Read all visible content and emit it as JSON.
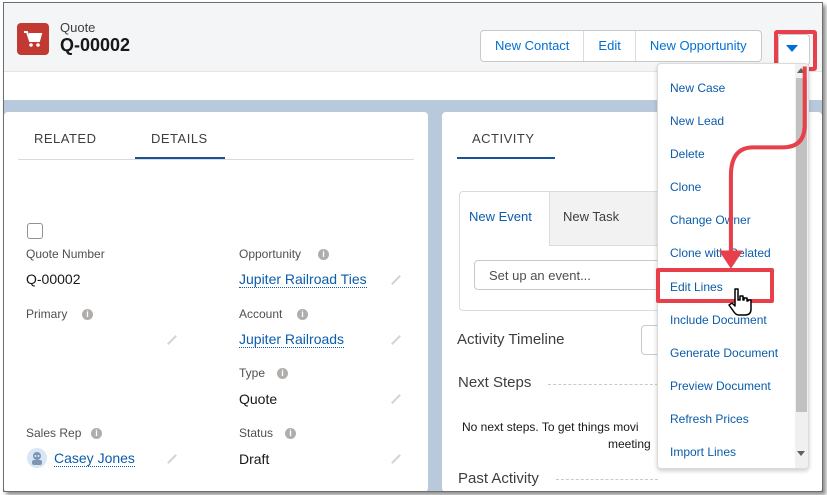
{
  "record": {
    "object_type": "Quote",
    "name": "Q-00002",
    "icon": "cart-icon"
  },
  "actions": {
    "new_contact": "New Contact",
    "edit": "Edit",
    "new_opportunity": "New Opportunity",
    "more_icon": "chevron-down-icon"
  },
  "left_tabs": {
    "related": "RELATED",
    "details": "DETAILS"
  },
  "details": {
    "quote_number_label": "Quote Number",
    "quote_number_value": "Q-00002",
    "opportunity_label": "Opportunity",
    "opportunity_value": "Jupiter Railroad Ties",
    "primary_label": "Primary",
    "account_label": "Account",
    "account_value": "Jupiter Railroads",
    "type_label": "Type",
    "type_value": "Quote",
    "sales_rep_label": "Sales Rep",
    "sales_rep_value": "Casey Jones",
    "status_label": "Status",
    "status_value": "Draft"
  },
  "activity": {
    "tab": "ACTIVITY",
    "new_event": "New Event",
    "new_task": "New Task",
    "event_placeholder": "Set up an event...",
    "timeline_title": "Activity Timeline",
    "next_steps": "Next Steps",
    "empty_message_line1": "No next steps. To get things movi",
    "empty_message_line2": "meeting",
    "past_activity": "Past Activity"
  },
  "menu": {
    "items": [
      "New Case",
      "New Lead",
      "Delete",
      "Clone",
      "Change Owner",
      "Clone with Related",
      "Edit Lines",
      "Include Document",
      "Generate Document",
      "Preview Document",
      "Refresh Prices",
      "Import Lines"
    ]
  },
  "colors": {
    "highlight": "#e8404a",
    "link": "#0b5cab",
    "quote_icon": "#c23934"
  }
}
